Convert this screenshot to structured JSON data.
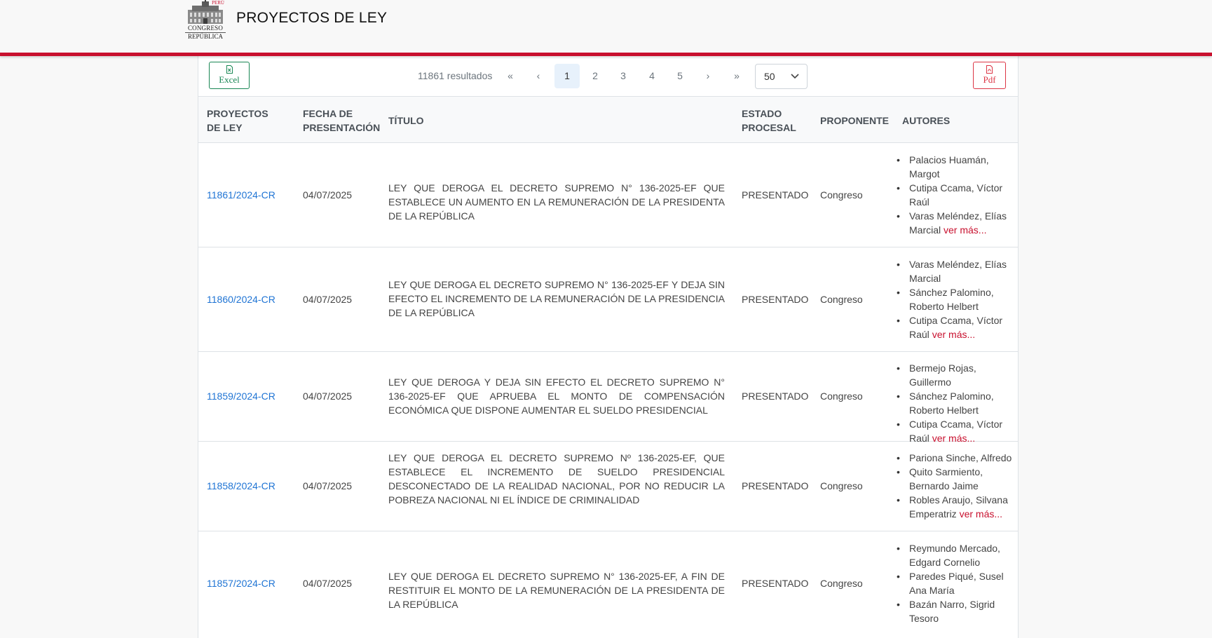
{
  "header": {
    "logo_small": "PERÚ",
    "logo_line1": "CONGRESO",
    "logo_line2": "REPÚBLICA",
    "title": "PROYECTOS DE LEY"
  },
  "toolbar": {
    "excel_label": "Excel",
    "pdf_label": "Pdf",
    "results": "11861 resultados",
    "first_label": "«",
    "prev_label": "‹",
    "next_label": "›",
    "last_label": "»",
    "pages": [
      "1",
      "2",
      "3",
      "4",
      "5"
    ],
    "current_page": "1",
    "per_page": "50"
  },
  "columns": [
    "PROYECTOS DE LEY",
    "FECHA DE PRESENTACIÓN",
    "TÍTULO",
    "ESTADO PROCESAL",
    "PROPONENTE",
    "AUTORES"
  ],
  "rows": [
    {
      "numero": "11861/2024-CR",
      "fecha": "04/07/2025",
      "titulo": "LEY QUE DEROGA EL DECRETO SUPREMO N° 136-2025-EF QUE ESTABLECE UN AUMENTO EN LA REMUNERACIÓN DE LA PRESIDENTA DE LA REPÚBLICA",
      "estado": "PRESENTADO",
      "proponente": "Congreso",
      "autores": [
        "Palacios Huamán, Margot",
        "Cutipa Ccama, Víctor Raúl",
        "Varas Meléndez, Elías Marcial"
      ],
      "ver_mas": "ver más..."
    },
    {
      "numero": "11860/2024-CR",
      "fecha": "04/07/2025",
      "titulo": "LEY QUE DEROGA EL DECRETO SUPREMO N° 136-2025-EF Y DEJA SIN EFECTO EL INCREMENTO DE LA REMUNERACIÓN DE LA PRESIDENCIA DE LA REPÚBLICA",
      "estado": "PRESENTADO",
      "proponente": "Congreso",
      "autores": [
        "Varas Meléndez, Elías Marcial",
        "Sánchez Palomino, Roberto Helbert",
        "Cutipa Ccama, Víctor Raúl"
      ],
      "ver_mas": "ver más..."
    },
    {
      "numero": "11859/2024-CR",
      "fecha": "04/07/2025",
      "titulo": "LEY QUE DEROGA Y DEJA SIN EFECTO EL DECRETO SUPREMO N° 136-2025-EF QUE APRUEBA EL MONTO DE COMPENSACIÓN ECONÓMICA QUE DISPONE AUMENTAR EL SUELDO PRESIDENCIAL",
      "estado": "PRESENTADO",
      "proponente": "Congreso",
      "autores": [
        "Bermejo Rojas, Guillermo",
        "Sánchez Palomino, Roberto Helbert",
        "Cutipa Ccama, Víctor Raúl"
      ],
      "ver_mas": "ver más..."
    },
    {
      "numero": "11858/2024-CR",
      "fecha": "04/07/2025",
      "titulo": "LEY QUE DEROGA EL DECRETO SUPREMO Nº 136-2025-EF, QUE ESTABLECE EL INCREMENTO DE SUELDO PRESIDENCIAL DESCONECTADO DE LA REALIDAD NACIONAL, POR NO REDUCIR LA POBREZA NACIONAL NI EL ÍNDICE DE CRIMINALIDAD",
      "estado": "PRESENTADO",
      "proponente": "Congreso",
      "autores": [
        "Pariona Sinche, Alfredo",
        "Quito Sarmiento, Bernardo Jaime",
        "Robles Araujo, Silvana Emperatriz"
      ],
      "ver_mas": "ver más..."
    },
    {
      "numero": "11857/2024-CR",
      "fecha": "04/07/2025",
      "titulo": "LEY QUE DEROGA EL DECRETO SUPREMO N° 136-2025-EF, A FIN DE RESTITUIR EL MONTO DE LA REMUNERACIÓN DE LA PRESIDENTA DE LA REPÚBLICA",
      "estado": "PRESENTADO",
      "proponente": "Congreso",
      "autores": [
        "Reymundo Mercado, Edgard Cornelio",
        "Paredes Piqué, Susel Ana María",
        "Bazán Narro, Sigrid Tesoro"
      ],
      "ver_mas": ""
    }
  ],
  "icons": {
    "excel": "file-excel-icon",
    "pdf": "file-pdf-icon"
  },
  "colors": {
    "accent_red": "#c8102e",
    "link_blue": "#1f74d4",
    "excel_green": "#198754",
    "pdf_red": "#dc3545"
  }
}
